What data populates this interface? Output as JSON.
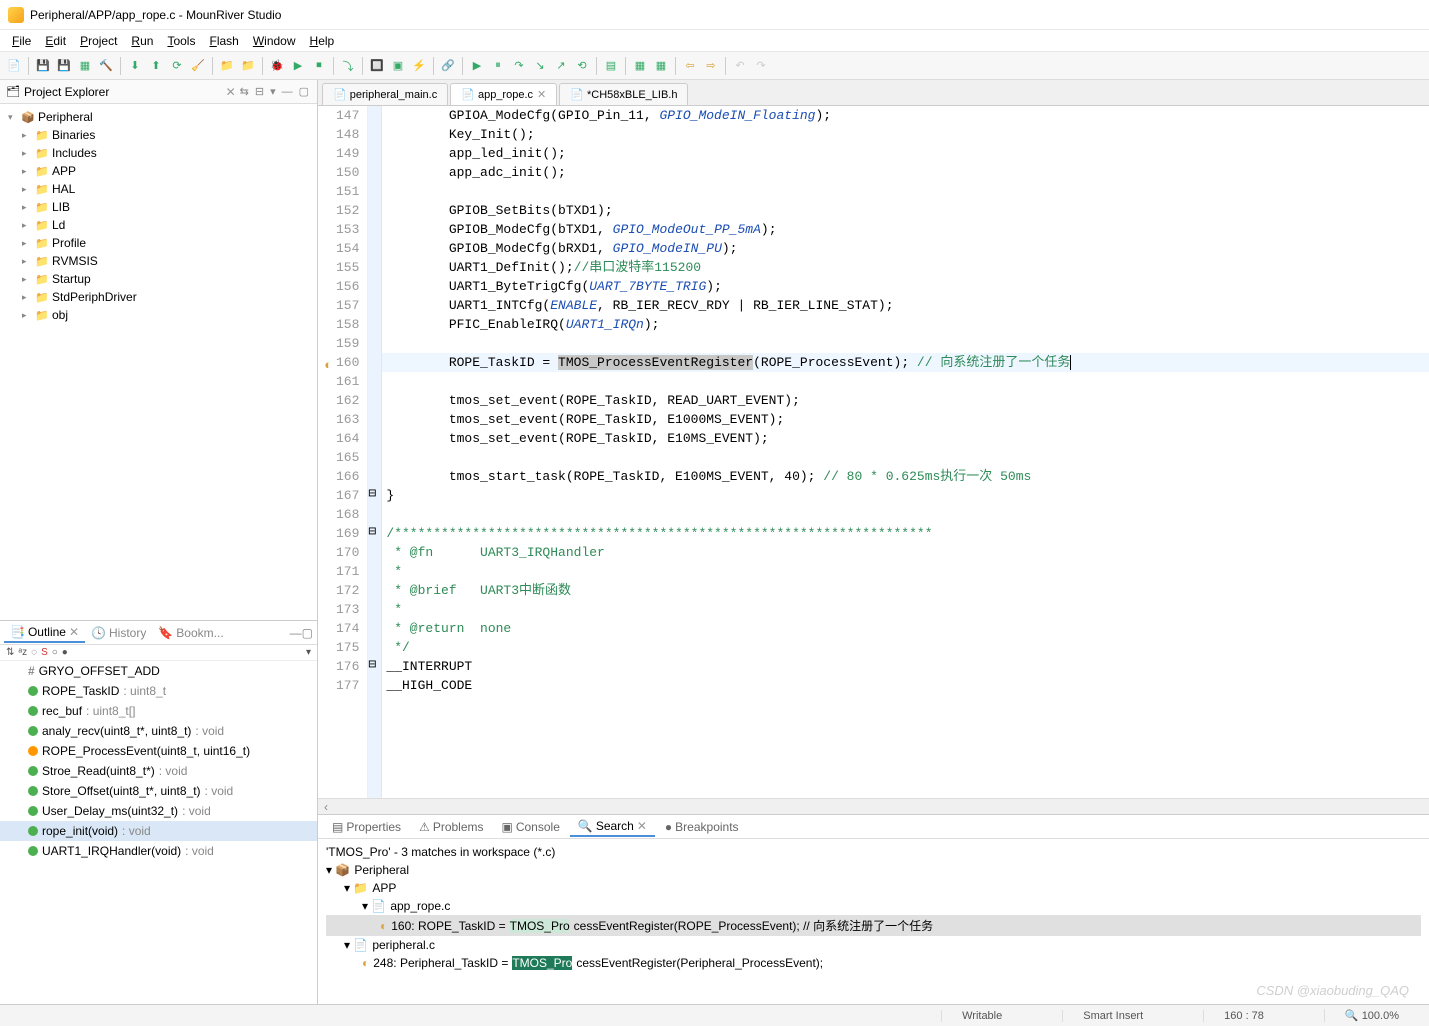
{
  "window": {
    "title": "Peripheral/APP/app_rope.c - MounRiver Studio"
  },
  "menu": [
    "File",
    "Edit",
    "Project",
    "Run",
    "Tools",
    "Flash",
    "Window",
    "Help"
  ],
  "project_explorer": {
    "title": "Project Explorer",
    "root": "Peripheral",
    "children": [
      "Binaries",
      "Includes",
      "APP",
      "HAL",
      "LIB",
      "Ld",
      "Profile",
      "RVMSIS",
      "Startup",
      "StdPeriphDriver",
      "obj"
    ]
  },
  "outline": {
    "tabs": [
      "Outline",
      "History",
      "Bookm..."
    ],
    "items": [
      {
        "k": "#",
        "name": "GRYO_OFFSET_ADD",
        "t": ""
      },
      {
        "k": "g",
        "name": "ROPE_TaskID",
        "t": ": uint8_t"
      },
      {
        "k": "g",
        "name": "rec_buf",
        "t": ": uint8_t[]"
      },
      {
        "k": "g",
        "name": "analy_recv(uint8_t*, uint8_t)",
        "t": ": void"
      },
      {
        "k": "o",
        "name": "ROPE_ProcessEvent(uint8_t, uint16_t)",
        "t": ""
      },
      {
        "k": "g",
        "name": "Stroe_Read(uint8_t*)",
        "t": ": void"
      },
      {
        "k": "g",
        "name": "Store_Offset(uint8_t*, uint8_t)",
        "t": ": void"
      },
      {
        "k": "g",
        "name": "User_Delay_ms(uint32_t)",
        "t": ": void"
      },
      {
        "k": "g",
        "name": "rope_init(void)",
        "t": ": void",
        "sel": true
      },
      {
        "k": "g",
        "name": "UART1_IRQHandler(void)",
        "t": ": void"
      }
    ]
  },
  "editor": {
    "tabs": [
      {
        "label": "peripheral_main.c",
        "active": false
      },
      {
        "label": "app_rope.c",
        "active": true,
        "close": true
      },
      {
        "label": "*CH58xBLE_LIB.h",
        "active": false
      }
    ],
    "lines": [
      {
        "n": 147,
        "html": "        GPIOA_ModeCfg(GPIO_Pin_11, <span class='kw-blue'>GPIO_ModeIN_Floating</span>);"
      },
      {
        "n": 148,
        "html": "        Key_Init();"
      },
      {
        "n": 149,
        "html": "        app_led_init();"
      },
      {
        "n": 150,
        "html": "        app_adc_init();"
      },
      {
        "n": 151,
        "html": ""
      },
      {
        "n": 152,
        "html": "        GPIOB_SetBits(bTXD1);"
      },
      {
        "n": 153,
        "html": "        GPIOB_ModeCfg(bTXD1, <span class='kw-blue'>GPIO_ModeOut_PP_5mA</span>);"
      },
      {
        "n": 154,
        "html": "        GPIOB_ModeCfg(bRXD1, <span class='kw-blue'>GPIO_ModeIN_PU</span>);"
      },
      {
        "n": 155,
        "html": "        UART1_DefInit();<span class='cmt'>//串口波特率115200</span>"
      },
      {
        "n": 156,
        "html": "        UART1_ByteTrigCfg(<span class='kw-blue'>UART_7BYTE_TRIG</span>);"
      },
      {
        "n": 157,
        "html": "        UART1_INTCfg(<span class='kw-blue'>ENABLE</span>, RB_IER_RECV_RDY | RB_IER_LINE_STAT);"
      },
      {
        "n": 158,
        "html": "        PFIC_EnableIRQ(<span class='kw-blue'>UART1_IRQn</span>);"
      },
      {
        "n": 159,
        "html": ""
      },
      {
        "n": 160,
        "html": "        ROPE_TaskID = <span class='sel-hl'>TMOS_ProcessEventRegister</span>(ROPE_ProcessEvent); <span class='cmt'>// 向系统注册了一个任务</span><span class='cursor-line'></span>",
        "hl": true,
        "mark": "◐"
      },
      {
        "n": 161,
        "html": ""
      },
      {
        "n": 162,
        "html": "        tmos_set_event(ROPE_TaskID, READ_UART_EVENT);"
      },
      {
        "n": 163,
        "html": "        tmos_set_event(ROPE_TaskID, E1000MS_EVENT);"
      },
      {
        "n": 164,
        "html": "        tmos_set_event(ROPE_TaskID, E10MS_EVENT);"
      },
      {
        "n": 165,
        "html": ""
      },
      {
        "n": 166,
        "html": "        tmos_start_task(ROPE_TaskID, E100MS_EVENT, 40); <span class='cmt'>// 80 * 0.625ms执行一次 50ms</span>"
      },
      {
        "n": 167,
        "html": "}",
        "fold": "⊟"
      },
      {
        "n": 168,
        "html": ""
      },
      {
        "n": 169,
        "html": "<span class='cmt'>/*********************************************************************</span>",
        "fold": "⊟"
      },
      {
        "n": 170,
        "html": "<span class='cmt'> * @fn      UART3_IRQHandler</span>"
      },
      {
        "n": 171,
        "html": "<span class='cmt'> *</span>"
      },
      {
        "n": 172,
        "html": "<span class='cmt'> * @brief   UART3中断函数</span>"
      },
      {
        "n": 173,
        "html": "<span class='cmt'> *</span>"
      },
      {
        "n": 174,
        "html": "<span class='cmt'> * @return  none</span>"
      },
      {
        "n": 175,
        "html": "<span class='cmt'> */</span>"
      },
      {
        "n": 176,
        "html": "__INTERRUPT",
        "fold": "⊟"
      },
      {
        "n": 177,
        "html": "__HIGH_CODE"
      }
    ]
  },
  "bottom": {
    "tabs": [
      "Properties",
      "Problems",
      "Console",
      "Search",
      "Breakpoints"
    ],
    "active": "Search",
    "summary": "'TMOS_Pro' - 3 matches in workspace (*.c)",
    "tree": {
      "root": "Peripheral",
      "folder": "APP",
      "file1": "app_rope.c",
      "match1_pre": "160: ROPE_TaskID = ",
      "match1_hl": "TMOS_Pro",
      "match1_post": "cessEventRegister(ROPE_ProcessEvent); // 向系统注册了一个任务",
      "file2": "peripheral.c",
      "match2_pre": "248: Peripheral_TaskID = ",
      "match2_hl": "TMOS_Pro",
      "match2_post": "cessEventRegister(Peripheral_ProcessEvent);"
    }
  },
  "status": {
    "writable": "Writable",
    "insert": "Smart Insert",
    "pos": "160 : 78",
    "zoom": "100.0%"
  },
  "watermark": "CSDN @xiaobuding_QAQ"
}
